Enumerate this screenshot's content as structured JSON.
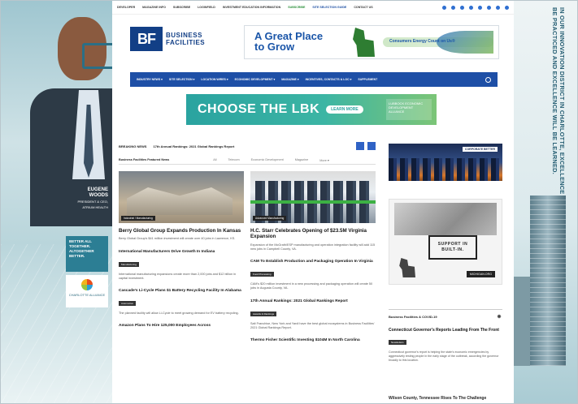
{
  "skin_left": {
    "person_name": "EUGENE WOODS",
    "person_title": "PRESIDENT & CEO, ATRIUM HEALTH",
    "cta": "BETTER ALL TOGETHER. ALTOGETHER BETTER.",
    "logo": "CHARLOTTE ALLIANCE"
  },
  "skin_right": {
    "text": "IN OUR INNOVATION DISTRICT IN CHARLOTTE, EXCELLENCE WILL BE PRACTICED AND EXCELLENCE WILL BE LEARNED."
  },
  "topbar": {
    "links": [
      "DEVELOPER",
      "MAGAZINE INFO",
      "SUBSCRIBE",
      "LOGINFIELD",
      "INVESTMENT EDUCATION INFORMATION"
    ],
    "subscribe": "SUBSCRIBE",
    "contact": "SITE SELECTION GUIDE",
    "contact2": "CONTACT US"
  },
  "brand": {
    "logo_mark": "BF",
    "logo_line1": "BUSINESS",
    "logo_line2": "FACILITIES"
  },
  "ad_top": {
    "headline_line1": "A Great Place",
    "headline_line2": "to Grow",
    "sponsor": "Consumers Energy  Count on Us®"
  },
  "nav": {
    "items": [
      "INDUSTRY NEWS ▾",
      "SITE SELECTION ▾",
      "LOCATION WIRES ▾",
      "ECONOMIC DEVELOPMENT ▾",
      "MAGAZINE ▾",
      "INCENTIVES, CONTACTS & LOC ▾",
      "SUPPLEMENT"
    ]
  },
  "ad_lbk": {
    "headline": "CHOOSE THE LBK",
    "button": "LEARN MORE",
    "partner": "LUBBOCK ECONOMIC DEVELOPMENT ALLIANCE"
  },
  "breaking": {
    "label": "BREAKING NEWS",
    "text": "17th Annual Rankings: 2021 Global Rankings Report"
  },
  "tabs": {
    "first": "Business Facilities Featured News",
    "items": [
      "All",
      "Telecom",
      "Economic Development",
      "Magazine",
      "More ▾"
    ]
  },
  "featured": [
    {
      "category": "Industrial / Manufacturing",
      "title": "Berry Global Group Expands Production In Kansas",
      "excerpt": "Berry Global Group's $41 million investment will create over 40 jobs in Lawrence, KS."
    },
    {
      "category": "Advanced Manufacturing",
      "title": "H.C. Starr Celebrates Opening of $23.5M Virginia Expansion",
      "excerpt": "Expansion of the McGrath/ESP manufacturing and operation integration facility will add 115 new jobs in Campbell County, VA."
    }
  ],
  "list_left": [
    {
      "title": "International Manufacturers Drive Growth In Indiana",
      "tag": "Manufacturing",
      "excerpt": "International manufacturing expansions create more than 2,000 jobs and $12 billion in capital investment."
    },
    {
      "title": "Cascade's Li-Cycle Plans $1 Battery Recycling Facility In Alabama",
      "tag": "Automotive",
      "excerpt": "The planned facility will allow Li-Cycle to meet growing demand for EV battery recycling."
    },
    {
      "title": "Amazon Plans To Hire 125,000 Employees Across"
    }
  ],
  "list_right": [
    {
      "title": "CAM To Establish Production and Packaging Operation In Virginia",
      "tag": "Food Processing",
      "excerpt": "CAM's $20 million investment in a new processing and packaging operation will create 50 jobs in Augusta County, VA."
    },
    {
      "title": "17th Annual Rankings: 2021 Global Rankings Report",
      "tag": "Awards & Rankings",
      "excerpt": "Salt Franchise, New York and Yardi have the best global ecosystems in Business Facilities' 2021 Global Rankings Report."
    },
    {
      "title": "Thermo Fisher Scientific Investing $104M In North Carolina"
    }
  ],
  "sidebar": {
    "ad_city_badge": "CORPORATE BETTER",
    "ad_built_headline_1": "SUPPORT IN",
    "ad_built_headline_2": "BUILT-IN.",
    "ad_built_cta": "MICHIGAN.ORG",
    "covid_header": "Business Facilities & COVID-19",
    "covid_title": "Connecticut Governor's Reports Leading From The Front",
    "covid_tag": "Newsletters",
    "covid_excerpt": "Connecticut governor's report is helping the state's economic emergencies by aggressively testing people in the early stage of the outbreak, according the governor broadly to this location.",
    "covid_title2": "Wilson County, Tennessee Rises To The Challenge"
  },
  "colors": {
    "nav_blue": "#1e4fa6",
    "brand_blue": "#123f86",
    "lbk_teal": "#2aa3a0"
  }
}
